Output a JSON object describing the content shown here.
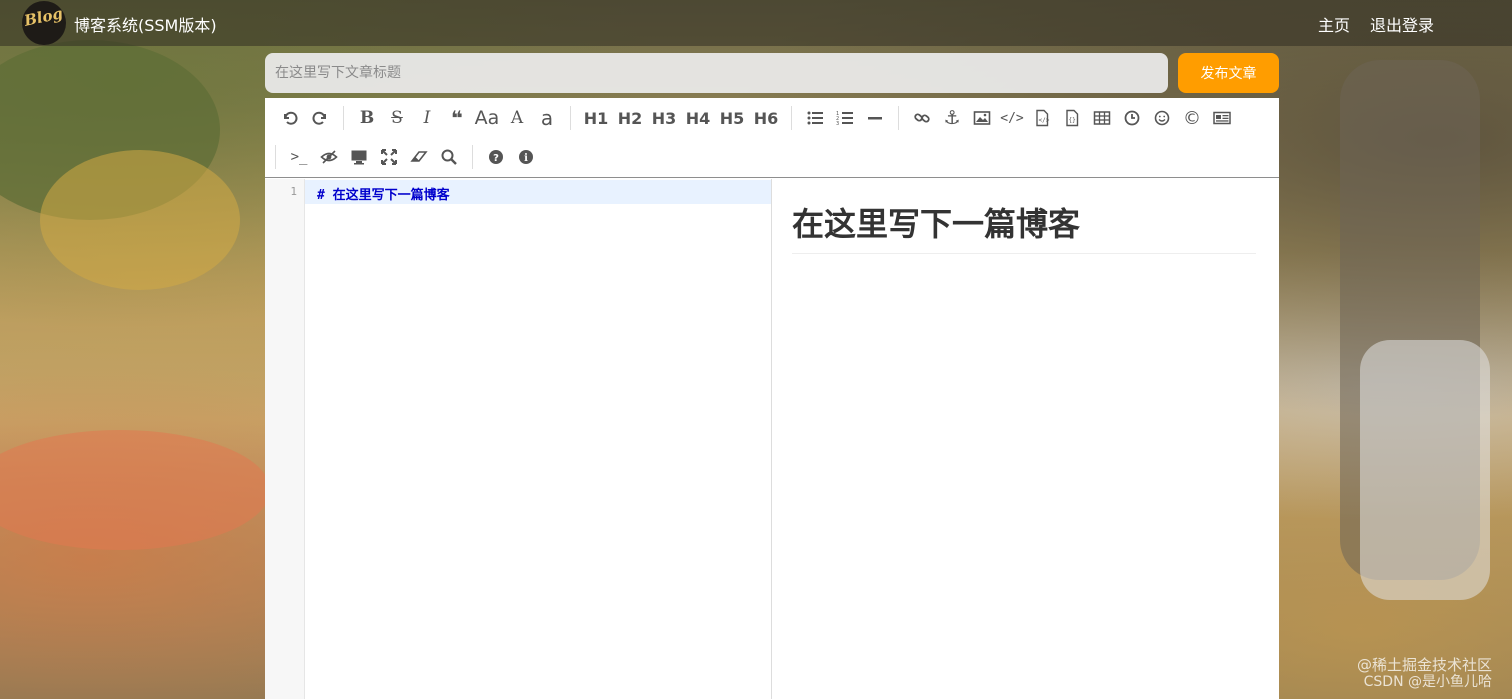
{
  "nav": {
    "logo_text": "Blog",
    "brand": "博客系统(SSM版本)",
    "links": [
      "主页",
      "退出登录"
    ]
  },
  "editor_header": {
    "title_placeholder": "在这里写下文章标题",
    "publish_label": "发布文章"
  },
  "toolbar": {
    "row1": [
      {
        "icon": "undo-icon"
      },
      {
        "icon": "redo-icon"
      },
      {
        "sep": true
      },
      {
        "icon": "bold-icon",
        "glyph": "B"
      },
      {
        "icon": "strikethrough-icon",
        "glyph": "S"
      },
      {
        "icon": "italic-icon",
        "glyph": "I"
      },
      {
        "icon": "quote-icon",
        "glyph": "❝"
      },
      {
        "icon": "uppercase-icon",
        "glyph": "Aa"
      },
      {
        "icon": "font-upper-icon",
        "glyph": "A"
      },
      {
        "icon": "font-lower-icon",
        "glyph": "a"
      },
      {
        "sep": true
      },
      {
        "label": "H1"
      },
      {
        "label": "H2"
      },
      {
        "label": "H3"
      },
      {
        "label": "H4"
      },
      {
        "label": "H5"
      },
      {
        "label": "H6"
      },
      {
        "sep": true
      },
      {
        "icon": "unordered-list-icon"
      },
      {
        "icon": "ordered-list-icon"
      },
      {
        "icon": "horizontal-rule-icon"
      },
      {
        "sep": true
      },
      {
        "icon": "link-icon"
      },
      {
        "icon": "anchor-icon"
      },
      {
        "icon": "image-icon"
      },
      {
        "icon": "code-icon"
      },
      {
        "icon": "code-block-icon"
      },
      {
        "icon": "code-file-icon"
      },
      {
        "icon": "table-icon"
      },
      {
        "icon": "datetime-icon"
      },
      {
        "icon": "emoji-icon"
      },
      {
        "icon": "html-entities-icon"
      },
      {
        "icon": "pagebreak-icon"
      }
    ],
    "row2": [
      {
        "icon": "terminal-icon"
      },
      {
        "icon": "watch-toggle-icon"
      },
      {
        "icon": "preview-icon"
      },
      {
        "icon": "fullscreen-icon"
      },
      {
        "icon": "clear-icon"
      },
      {
        "icon": "search-icon"
      },
      {
        "sep": true
      },
      {
        "icon": "help-icon"
      },
      {
        "icon": "info-icon"
      }
    ]
  },
  "code": {
    "line_number": "1",
    "content": "# 在这里写下一篇博客"
  },
  "preview": {
    "heading": "在这里写下一篇博客"
  },
  "watermark": {
    "line1": "@稀土掘金技术社区",
    "line2": "CSDN @是小鱼儿哈"
  },
  "colors": {
    "publish_button": "#ff9d00",
    "code_heading": "#0000cc",
    "active_line": "#e8f2ff"
  }
}
